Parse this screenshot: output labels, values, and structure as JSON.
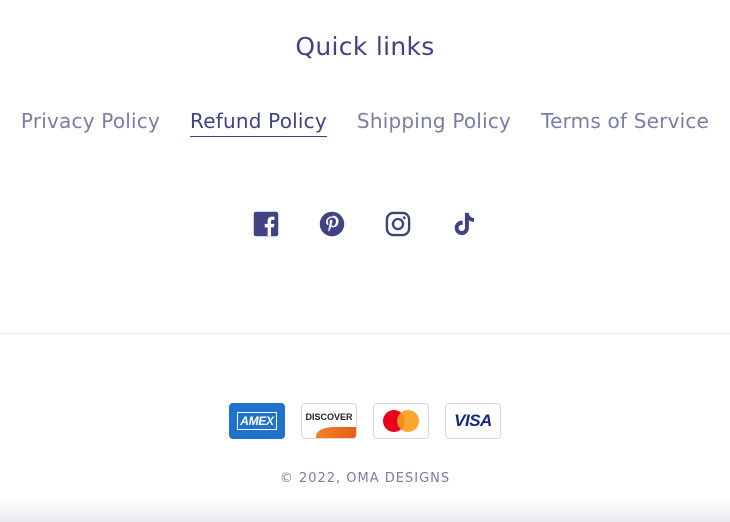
{
  "footer": {
    "heading": "Quick links",
    "links": [
      {
        "label": "Privacy Policy",
        "active": false
      },
      {
        "label": "Refund Policy",
        "active": true
      },
      {
        "label": "Shipping Policy",
        "active": false
      },
      {
        "label": "Terms of Service",
        "active": false
      }
    ],
    "social_icons": [
      "facebook-icon",
      "pinterest-icon",
      "instagram-icon",
      "tiktok-icon"
    ],
    "payment_methods": [
      {
        "icon": "amex-icon",
        "text": "AMEX"
      },
      {
        "icon": "discover-icon",
        "text": "DISCOVER"
      },
      {
        "icon": "mastercard-icon"
      },
      {
        "icon": "visa-icon",
        "text": "VISA"
      }
    ],
    "copyright": "© 2022, OMA DESIGNS"
  },
  "colors": {
    "primary": "#3f4383",
    "muted": "#7a7da6",
    "divider": "#ececf2"
  }
}
